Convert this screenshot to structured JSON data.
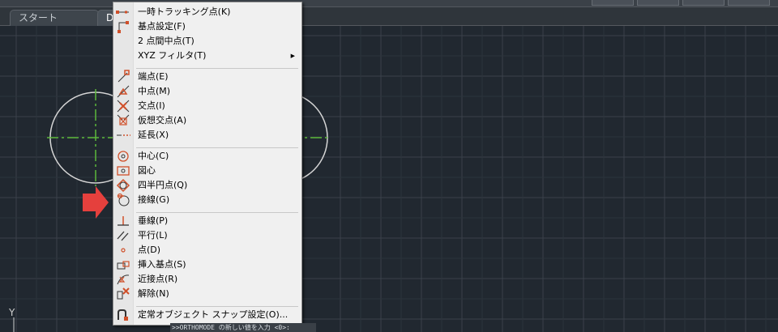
{
  "tabs": [
    {
      "label": "スタート"
    },
    {
      "label": "Dr"
    }
  ],
  "context_menu": {
    "items": [
      {
        "label": "一時トラッキング点(K)",
        "icon": "temporary-tracking-icon"
      },
      {
        "label": "基点設定(F)",
        "icon": "from-icon"
      },
      {
        "label": "2 点間中点(T)",
        "icon": "mid-between-2-points-icon"
      },
      {
        "label": "XYZ フィルタ(T)",
        "icon": "none",
        "submenu": "▶"
      },
      {
        "label": "端点(E)",
        "icon": "endpoint-icon"
      },
      {
        "label": "中点(M)",
        "icon": "midpoint-icon"
      },
      {
        "label": "交点(I)",
        "icon": "intersection-icon"
      },
      {
        "label": "仮想交点(A)",
        "icon": "apparent-intersection-icon"
      },
      {
        "label": "延長(X)",
        "icon": "extension-icon"
      },
      {
        "label": "中心(C)",
        "icon": "center-icon"
      },
      {
        "label": "図心",
        "icon": "geometric-center-icon"
      },
      {
        "label": "四半円点(Q)",
        "icon": "quadrant-icon"
      },
      {
        "label": "接線(G)",
        "icon": "tangent-icon"
      },
      {
        "label": "垂線(P)",
        "icon": "perpendicular-icon"
      },
      {
        "label": "平行(L)",
        "icon": "parallel-icon"
      },
      {
        "label": "点(D)",
        "icon": "node-icon"
      },
      {
        "label": "挿入基点(S)",
        "icon": "insertion-icon"
      },
      {
        "label": "近接点(R)",
        "icon": "nearest-icon"
      },
      {
        "label": "解除(N)",
        "icon": "none-snap-icon"
      },
      {
        "label": "定常オブジェクト スナップ設定(O)...",
        "icon": "osnap-settings-icon"
      }
    ]
  },
  "ucs_label": "Y",
  "command_line": ">>ORTHOMODE の新しい値を入力 <0>:",
  "colors": {
    "canvas": "#212830",
    "centerline": "#5cb83a",
    "circle": "#d6d6d6",
    "menu_bg": "#f0f0f0",
    "pointer_arrow": "#e5403d"
  }
}
